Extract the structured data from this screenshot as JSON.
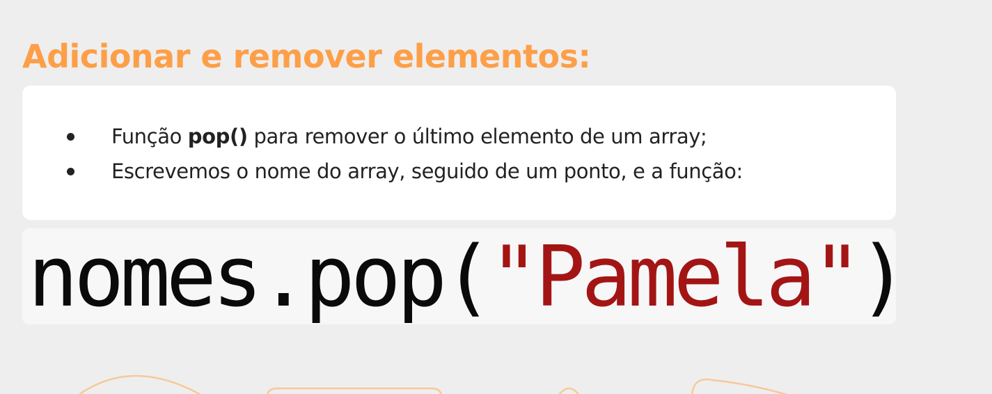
{
  "heading": "Adicionar e remover elementos:",
  "bullets": [
    {
      "prefix": "Função ",
      "bold": "pop()",
      "suffix": " para remover o último elemento de um array;"
    },
    {
      "prefix": "Escrevemos o nome do array, seguido de um ponto, e a função:",
      "bold": "",
      "suffix": ""
    }
  ],
  "code": {
    "object": "nomes",
    "dot": ".",
    "method": "pop",
    "open_paren": "(",
    "string": "\"Pamela\"",
    "close_paren": ")"
  },
  "colors": {
    "heading": "#fd9f48",
    "background": "#eeeeee",
    "card": "#ffffff",
    "text": "#222222",
    "code_text": "#0a0a0a",
    "code_string": "#a31515",
    "decoration": "#f8c89a"
  }
}
